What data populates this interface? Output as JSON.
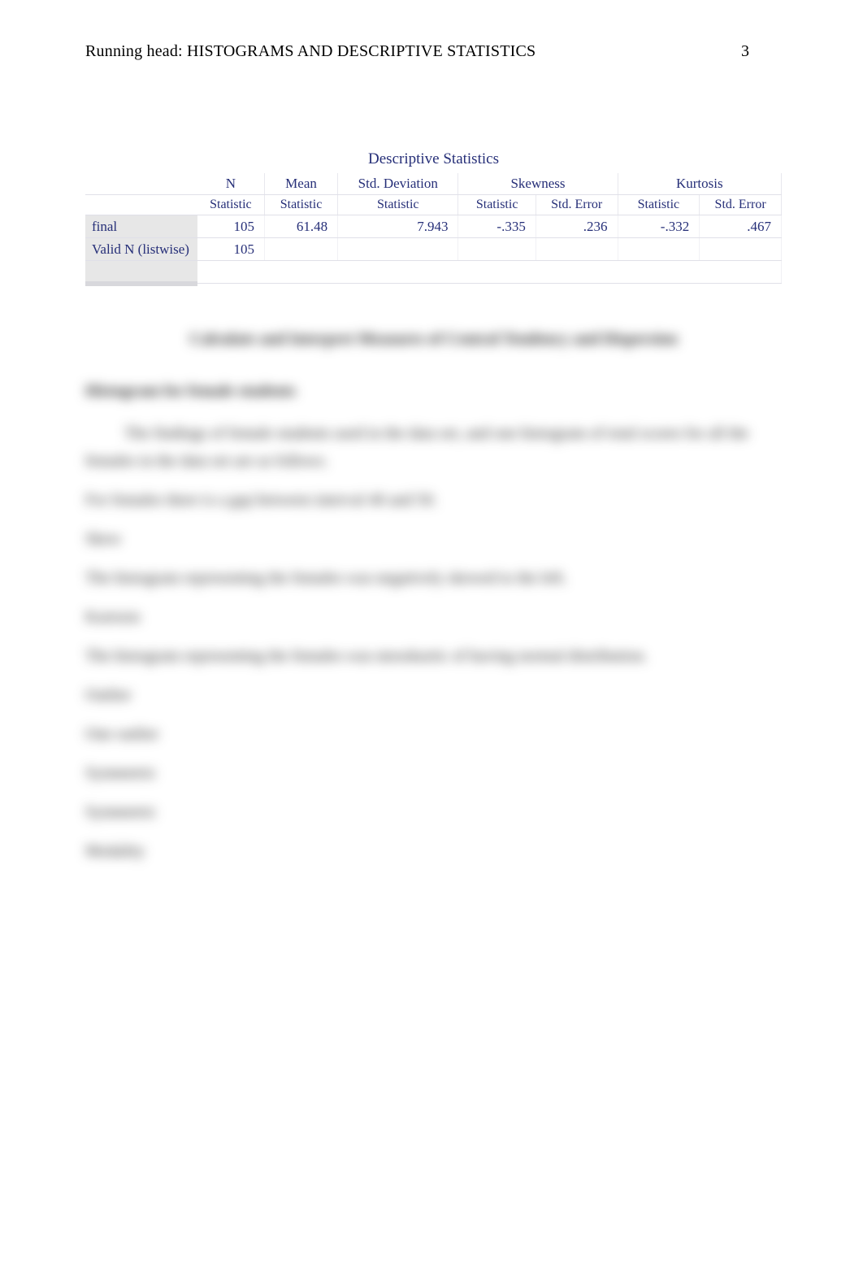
{
  "header": {
    "running_head": "Running head: HISTOGRAMS AND DESCRIPTIVE STATISTICS",
    "page_number": "3"
  },
  "table": {
    "title": "Descriptive Statistics",
    "group_headers": {
      "blank": "",
      "n": "N",
      "mean": "Mean",
      "std": "Std. Deviation",
      "skew": "Skewness",
      "kurt": "Kurtosis"
    },
    "sub_headers": {
      "statistic": "Statistic",
      "std_error": "Std. Error"
    },
    "rows": [
      {
        "label": "final",
        "n": "105",
        "mean": "61.48",
        "std": "7.943",
        "skew_stat": "-.335",
        "skew_err": ".236",
        "kurt_stat": "-.332",
        "kurt_err": ".467"
      },
      {
        "label": "Valid N (listwise)",
        "n": "105",
        "mean": "",
        "std": "",
        "skew_stat": "",
        "skew_err": "",
        "kurt_stat": "",
        "kurt_err": ""
      }
    ]
  },
  "blurred": {
    "heading": "Calculate and Interpret Measures of Central Tendency and Dispersion",
    "sub1": "Histogram for female students",
    "para1": "The findings of female students used in the data set, and one histogram of total scores for all the females in the data set are as follows.",
    "line1": "For females there is a gap between interval 40 and 50.",
    "line2": "Skew",
    "line3": "The histogram representing the females was negatively skewed to the left.",
    "line4": "Kurtosis",
    "line5": "The histogram representing the females was mesokurtic of having normal distribution.",
    "line6": "Outlier",
    "line7": "One outlier",
    "line8": "Symmetric",
    "line9": "Symmetric",
    "line10": "Modality"
  }
}
